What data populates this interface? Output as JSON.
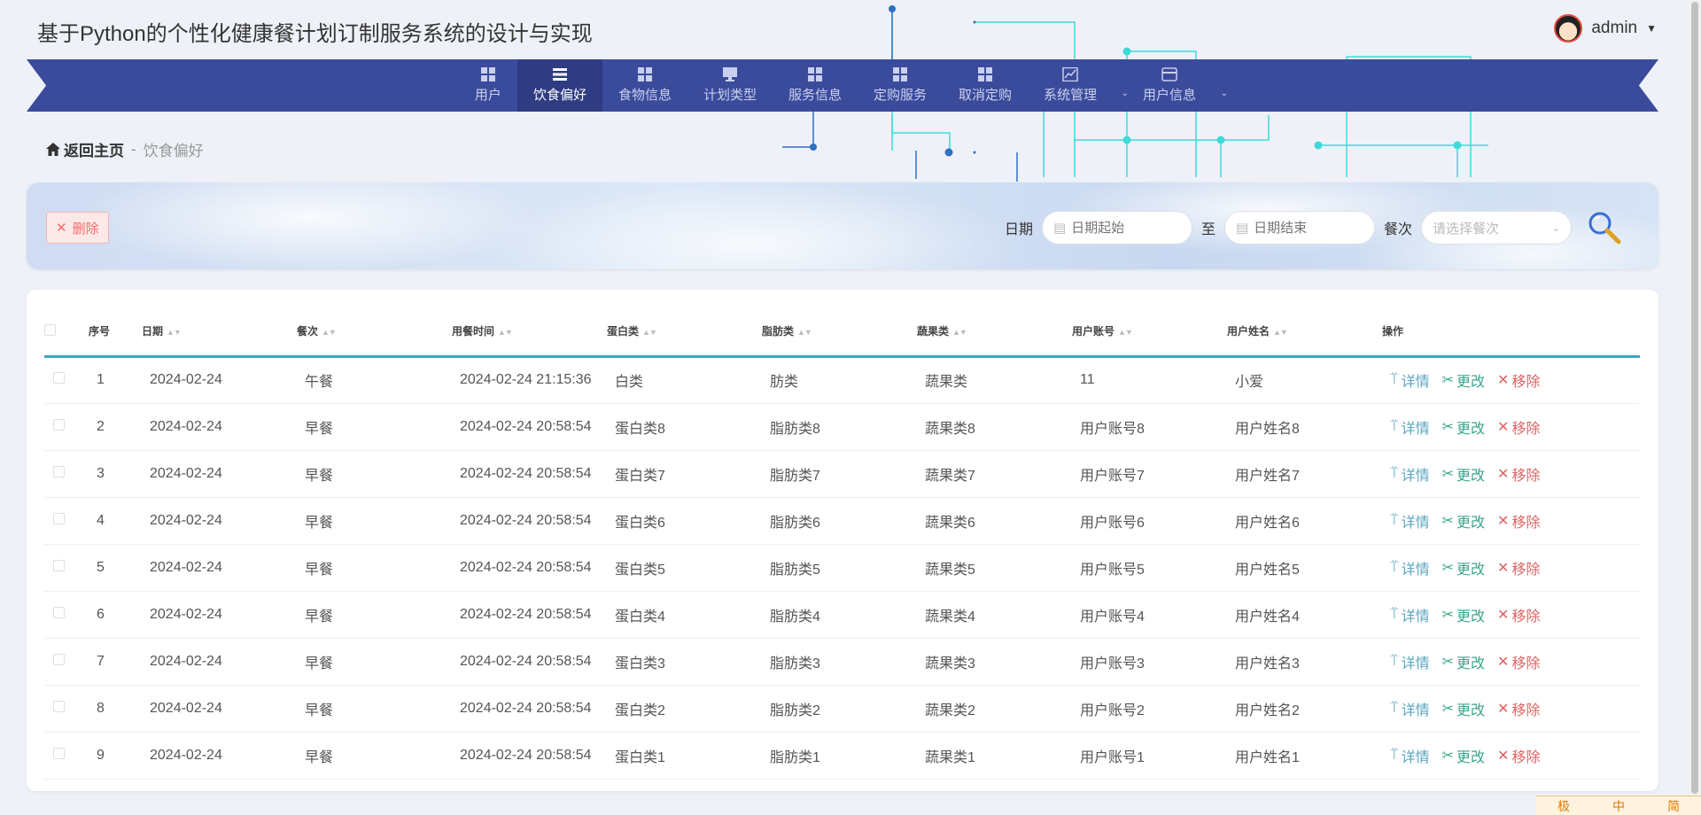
{
  "app": {
    "title": "基于Python的个性化健康餐计划订制服务系统的设计与实现",
    "user": "admin"
  },
  "nav": {
    "items": [
      {
        "label": "用户",
        "icon": "grid-icon",
        "active": false,
        "dropdown": false
      },
      {
        "label": "饮食偏好",
        "icon": "list-icon",
        "active": true,
        "dropdown": false
      },
      {
        "label": "食物信息",
        "icon": "grid-icon",
        "active": false,
        "dropdown": false
      },
      {
        "label": "计划类型",
        "icon": "monitor-icon",
        "active": false,
        "dropdown": false
      },
      {
        "label": "服务信息",
        "icon": "grid-icon",
        "active": false,
        "dropdown": false
      },
      {
        "label": "定购服务",
        "icon": "grid-icon",
        "active": false,
        "dropdown": false
      },
      {
        "label": "取消定购",
        "icon": "grid-icon",
        "active": false,
        "dropdown": false
      },
      {
        "label": "系统管理",
        "icon": "chart-icon",
        "active": false,
        "dropdown": true
      },
      {
        "label": "用户信息",
        "icon": "card-icon",
        "active": false,
        "dropdown": true
      }
    ]
  },
  "breadcrumb": {
    "home": "返回主页",
    "separator": "-",
    "current": "饮食偏好"
  },
  "search": {
    "delete_label": "删除",
    "date_label": "日期",
    "date_start_placeholder": "日期起始",
    "to_label": "至",
    "date_end_placeholder": "日期结束",
    "meal_label": "餐次",
    "meal_placeholder": "请选择餐次"
  },
  "table": {
    "headers": [
      "序号",
      "日期",
      "餐次",
      "用餐时间",
      "蛋白类",
      "脂肪类",
      "蔬果类",
      "用户账号",
      "用户姓名",
      "操作"
    ],
    "actions": {
      "detail": "详情",
      "edit": "更改",
      "remove": "移除"
    },
    "rows": [
      {
        "no": "1",
        "date": "2024-02-24",
        "meal": "午餐",
        "time": "2024-02-24 21:15:36",
        "protein": "白类",
        "fat": "肪类",
        "veg": "蔬果类",
        "account": "11",
        "name": "小爱"
      },
      {
        "no": "2",
        "date": "2024-02-24",
        "meal": "早餐",
        "time": "2024-02-24 20:58:54",
        "protein": "蛋白类8",
        "fat": "脂肪类8",
        "veg": "蔬果类8",
        "account": "用户账号8",
        "name": "用户姓名8"
      },
      {
        "no": "3",
        "date": "2024-02-24",
        "meal": "早餐",
        "time": "2024-02-24 20:58:54",
        "protein": "蛋白类7",
        "fat": "脂肪类7",
        "veg": "蔬果类7",
        "account": "用户账号7",
        "name": "用户姓名7"
      },
      {
        "no": "4",
        "date": "2024-02-24",
        "meal": "早餐",
        "time": "2024-02-24 20:58:54",
        "protein": "蛋白类6",
        "fat": "脂肪类6",
        "veg": "蔬果类6",
        "account": "用户账号6",
        "name": "用户姓名6"
      },
      {
        "no": "5",
        "date": "2024-02-24",
        "meal": "早餐",
        "time": "2024-02-24 20:58:54",
        "protein": "蛋白类5",
        "fat": "脂肪类5",
        "veg": "蔬果类5",
        "account": "用户账号5",
        "name": "用户姓名5"
      },
      {
        "no": "6",
        "date": "2024-02-24",
        "meal": "早餐",
        "time": "2024-02-24 20:58:54",
        "protein": "蛋白类4",
        "fat": "脂肪类4",
        "veg": "蔬果类4",
        "account": "用户账号4",
        "name": "用户姓名4"
      },
      {
        "no": "7",
        "date": "2024-02-24",
        "meal": "早餐",
        "time": "2024-02-24 20:58:54",
        "protein": "蛋白类3",
        "fat": "脂肪类3",
        "veg": "蔬果类3",
        "account": "用户账号3",
        "name": "用户姓名3"
      },
      {
        "no": "8",
        "date": "2024-02-24",
        "meal": "早餐",
        "time": "2024-02-24 20:58:54",
        "protein": "蛋白类2",
        "fat": "脂肪类2",
        "veg": "蔬果类2",
        "account": "用户账号2",
        "name": "用户姓名2"
      },
      {
        "no": "9",
        "date": "2024-02-24",
        "meal": "早餐",
        "time": "2024-02-24 20:58:54",
        "protein": "蛋白类1",
        "fat": "脂肪类1",
        "veg": "蔬果类1",
        "account": "用户账号1",
        "name": "用户姓名1"
      }
    ]
  },
  "ime": {
    "items": [
      "极",
      "中",
      "简"
    ]
  },
  "colors": {
    "nav_bg": "#3b4b9c",
    "nav_active": "#2f3b82",
    "accent_line": "#3aa5c3",
    "circuit_cyan": "#3fd9d9",
    "circuit_blue": "#2f6fc4",
    "danger": "#f56c6c"
  }
}
